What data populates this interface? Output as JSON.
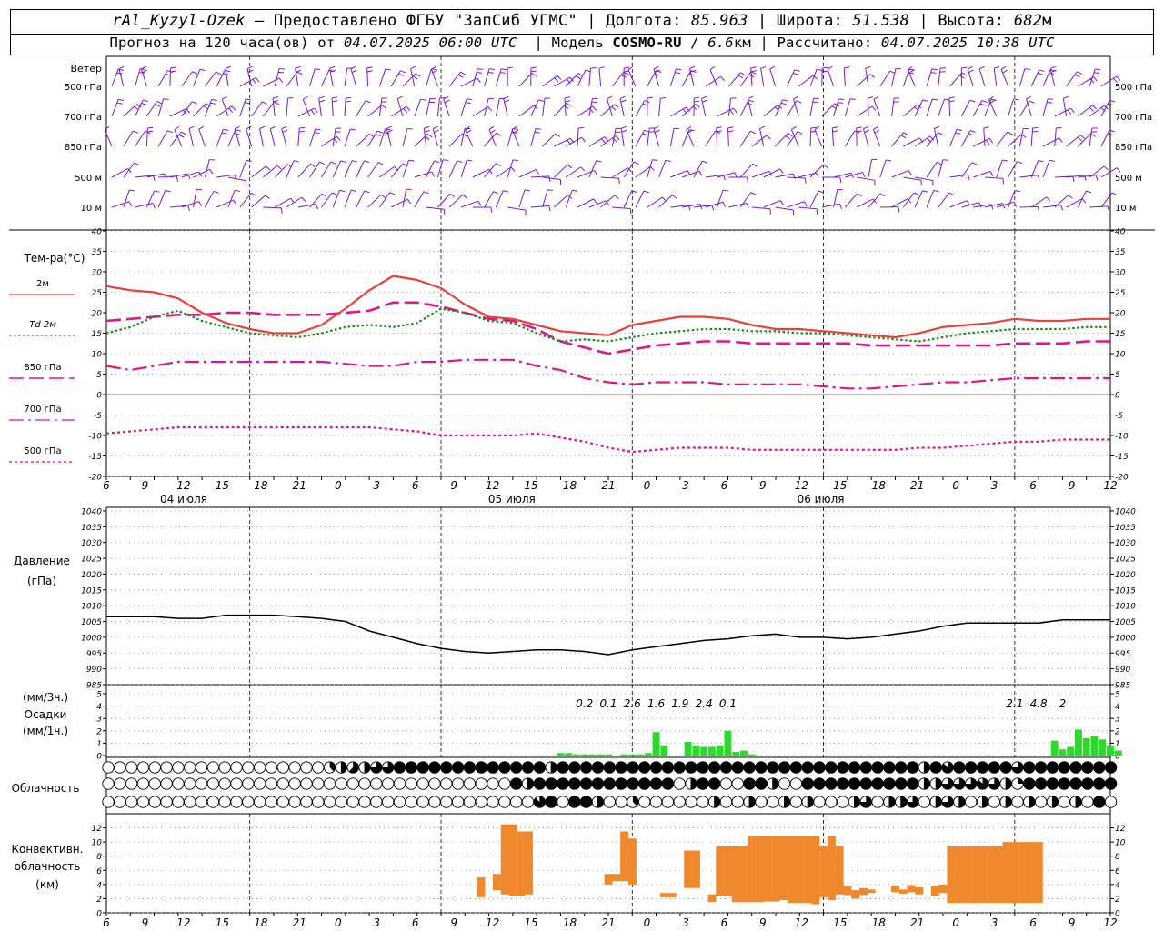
{
  "header": {
    "station": "rAl_Kyzyl-Ozek",
    "provider": "Предоставлено ФГБУ \"ЗапСиб УГМС\"",
    "lon_label": "Долгота:",
    "lon_value": "85.963",
    "lat_label": "Широта:",
    "lat_value": "51.538",
    "alt_label": "Высота:",
    "alt_value": "682",
    "alt_unit": "м",
    "forecast_prefix": "Прогноз на 120 часа(ов) от",
    "forecast_time": "04.07.2025 06:00 UTC",
    "model_label": "Модель",
    "model_name": "COSMO-RU",
    "model_res": "6.6",
    "model_res_unit": "км",
    "calc_label": "Рассчитано:",
    "calc_time": "04.07.2025 10:38 UTC"
  },
  "wind_panel": {
    "title": "Ветер",
    "levels": [
      "500 гПа",
      "700 гПа",
      "850 гПа",
      "500 м",
      "10 м"
    ],
    "barb_color": "#7b19d0"
  },
  "chart_data": [
    {
      "type": "line",
      "name": "temperature",
      "ylabel": "Тем-ра(°С)",
      "ylim": [
        -20,
        40
      ],
      "yticks": [
        -20,
        -15,
        -10,
        -5,
        0,
        5,
        10,
        15,
        20,
        25,
        30,
        35,
        40
      ],
      "x_hours_from_start": [
        0,
        3,
        6,
        9,
        12,
        15,
        18,
        21,
        24,
        27,
        30,
        33,
        36,
        39,
        42,
        45,
        48,
        51,
        54,
        57,
        60,
        63,
        66,
        69,
        72,
        75,
        78,
        81,
        84,
        87,
        90,
        93,
        96,
        99,
        102,
        105,
        108,
        111,
        114,
        117,
        120,
        123,
        126
      ],
      "legend": [
        {
          "label": "2м",
          "color": "#e8403a"
        },
        {
          "label": "Td  2м",
          "color": "#1b8a1b"
        },
        {
          "label": "850 гПа",
          "color": "#e0148c"
        },
        {
          "label": "700 гПа",
          "color": "#e0148c"
        },
        {
          "label": "500 гПа",
          "color": "#e0148c"
        }
      ],
      "series": [
        {
          "name": "2м",
          "color": "#e8403a",
          "values": [
            26.5,
            25.5,
            25,
            23.5,
            20,
            17.5,
            16,
            15,
            15,
            17,
            21,
            25.5,
            29,
            28,
            26,
            22,
            19,
            18.5,
            17,
            15.5,
            15,
            14.5,
            17,
            18,
            19,
            19,
            18.5,
            17,
            16,
            16,
            15.5,
            15,
            14.5,
            14,
            15,
            16.5,
            17,
            17.5,
            18.5,
            18,
            18,
            18.5,
            18.5
          ]
        },
        {
          "name": "Td  2м",
          "color": "#1b8a1b",
          "values": [
            15,
            16.5,
            19,
            20.5,
            18,
            16.5,
            15,
            14.5,
            14,
            15,
            16.5,
            17,
            16.5,
            17.5,
            21,
            20,
            18,
            17.5,
            15,
            13,
            13.5,
            13,
            14,
            15,
            15.5,
            16,
            16,
            15.5,
            15.5,
            15,
            15,
            14.5,
            14,
            13.5,
            13,
            14,
            15,
            15.5,
            16,
            16,
            16,
            16.5,
            16.5
          ]
        },
        {
          "name": "850 гПа",
          "color": "#e0148c",
          "values": [
            18,
            18.5,
            19,
            19.5,
            19.5,
            20,
            20,
            19.5,
            19.5,
            19.5,
            20,
            20.5,
            22.5,
            22.5,
            21.5,
            20,
            18.5,
            18,
            16,
            13,
            11.5,
            10,
            11,
            12,
            12.5,
            13,
            13,
            12.5,
            12.5,
            12.5,
            12.5,
            12.5,
            12,
            12,
            12,
            12,
            12,
            12,
            12.5,
            12.5,
            12.5,
            13,
            13
          ]
        },
        {
          "name": "700 гПа",
          "color": "#e0148c",
          "values": [
            7,
            6,
            7,
            8,
            8,
            8,
            8,
            8,
            8,
            8,
            7.5,
            7,
            7,
            8,
            8,
            8.5,
            8.5,
            8.5,
            7,
            6,
            4,
            3,
            2.5,
            3,
            3,
            3,
            2.5,
            2.5,
            2.5,
            2.5,
            2,
            1.5,
            1.5,
            2,
            2.5,
            3,
            3,
            3.5,
            4,
            4,
            4,
            4,
            4
          ]
        },
        {
          "name": "500 гПа",
          "color": "#e0148c",
          "values": [
            -9.5,
            -9,
            -8.5,
            -8,
            -8,
            -8,
            -8,
            -8,
            -8,
            -8,
            -8,
            -8,
            -8.5,
            -9,
            -10,
            -10,
            -10,
            -10,
            -9.5,
            -10.5,
            -11.5,
            -13,
            -14,
            -13.5,
            -13,
            -13,
            -13,
            -13.5,
            -13.5,
            -13.5,
            -13.5,
            -13.5,
            -13.5,
            -13.5,
            -13,
            -13,
            -12.5,
            -12,
            -11.5,
            -11.5,
            -11,
            -11,
            -11
          ]
        }
      ]
    },
    {
      "type": "line",
      "name": "pressure",
      "ylabel": "Давление",
      "ylabel2": "(гПа)",
      "ylim": [
        985,
        1040
      ],
      "yticks": [
        985,
        990,
        995,
        1000,
        1005,
        1010,
        1015,
        1020,
        1025,
        1030,
        1035,
        1040
      ],
      "x_hours_from_start": [
        0,
        3,
        6,
        9,
        12,
        15,
        18,
        21,
        24,
        27,
        30,
        33,
        36,
        39,
        42,
        45,
        48,
        51,
        54,
        57,
        60,
        63,
        66,
        69,
        72,
        75,
        78,
        81,
        84,
        87,
        90,
        93,
        96,
        99,
        102,
        105,
        108,
        111,
        114,
        117,
        120,
        123,
        126
      ],
      "series": [
        {
          "name": "pressure",
          "color": "#000000",
          "values": [
            1006.5,
            1006.5,
            1006.5,
            1006,
            1006,
            1007,
            1007,
            1007,
            1006.5,
            1006,
            1005,
            1002,
            1000,
            998,
            996.5,
            995.5,
            995,
            995.5,
            996,
            996,
            995.5,
            994.5,
            996,
            997,
            998,
            999,
            999.5,
            1000.5,
            1001,
            1000,
            1000,
            999.5,
            1000,
            1001,
            1002,
            1003.5,
            1004.5,
            1004.5,
            1004.5,
            1004.5,
            1005.5,
            1005.5,
            1005.5
          ]
        }
      ]
    },
    {
      "type": "bar",
      "name": "precipitation",
      "ylabel": "(мм/3ч.)",
      "ylabel2": "Осадки",
      "ylabel3": "(мм/1ч.)",
      "ylim": [
        0,
        5
      ],
      "yticks": [
        0,
        1,
        2,
        3,
        4,
        5
      ],
      "bar_color": "#2ed92e",
      "hourly_start_hour": 57,
      "hourly_values": [
        0.2,
        0.2,
        0.1,
        0.1,
        0.1,
        0.1,
        0.1,
        0,
        0.1,
        0.1,
        0.1,
        0.2,
        1.9,
        0.8,
        0,
        0,
        1.1,
        0.8,
        0.7,
        0.7,
        0.8,
        2.0,
        0.3,
        0.4,
        0.1,
        0,
        0,
        0,
        0,
        0,
        0,
        0,
        0,
        0,
        0,
        0,
        0,
        0,
        0,
        0,
        0,
        0,
        0,
        0,
        0,
        0,
        0,
        0,
        0,
        0,
        0,
        0,
        0,
        0,
        0,
        0,
        0,
        0,
        0,
        0,
        0,
        0,
        1.2,
        0.5,
        0.7,
        2.1,
        1.4,
        1.6,
        1.3,
        0.8,
        0.4
      ],
      "totals_3h": [
        {
          "x": 60,
          "label": "0.2"
        },
        {
          "x": 63,
          "label": "0.1"
        },
        {
          "x": 66,
          "label": "2.6"
        },
        {
          "x": 69,
          "label": "1.6"
        },
        {
          "x": 72,
          "label": "1.9"
        },
        {
          "x": 75,
          "label": "2.4"
        },
        {
          "x": 78,
          "label": "0.1"
        },
        {
          "x": 114,
          "label": "2.1"
        },
        {
          "x": 117,
          "label": "4.8"
        },
        {
          "x": 120,
          "label": "2"
        }
      ]
    },
    {
      "type": "table",
      "name": "cloudiness",
      "ylabel": "Облачность",
      "rows_eighths": [
        [
          0,
          0,
          0,
          0,
          0,
          0,
          0,
          0,
          0,
          0,
          0,
          0,
          0,
          0,
          0,
          0,
          0,
          0,
          0,
          3,
          4,
          5,
          4,
          6,
          6,
          8,
          8,
          8,
          8,
          8,
          8,
          8,
          8,
          8,
          8,
          8,
          8,
          8,
          4,
          8,
          8,
          8,
          8,
          8,
          8,
          8,
          8,
          8,
          8,
          8,
          8,
          8,
          8,
          8,
          8,
          8,
          8,
          8,
          8,
          8,
          8,
          8,
          8,
          8,
          8,
          8,
          8,
          8,
          8,
          8,
          4,
          8,
          7,
          8,
          8,
          8,
          8,
          8,
          6,
          8,
          8,
          8,
          8,
          8,
          8,
          8,
          8
        ],
        [
          0,
          0,
          0,
          0,
          0,
          0,
          0,
          0,
          0,
          0,
          0,
          0,
          0,
          0,
          0,
          0,
          0,
          0,
          0,
          0,
          0,
          0,
          0,
          0,
          0,
          0,
          0,
          0,
          0,
          0,
          0,
          0,
          0,
          0,
          0,
          8,
          4,
          8,
          8,
          8,
          8,
          8,
          8,
          8,
          8,
          8,
          8,
          8,
          8,
          0,
          4,
          8,
          8,
          0,
          0,
          8,
          8,
          4,
          0,
          0,
          8,
          8,
          8,
          8,
          8,
          8,
          8,
          8,
          8,
          8,
          4,
          4,
          6,
          6,
          6,
          7,
          6,
          4,
          2,
          8,
          8,
          8,
          8,
          8,
          8,
          8,
          8
        ],
        [
          0,
          0,
          0,
          0,
          0,
          0,
          0,
          0,
          0,
          0,
          0,
          0,
          0,
          0,
          0,
          0,
          0,
          0,
          0,
          0,
          0,
          0,
          0,
          0,
          0,
          0,
          0,
          0,
          0,
          0,
          0,
          0,
          0,
          0,
          0,
          0,
          0,
          7,
          8,
          0,
          8,
          8,
          4,
          0,
          0,
          3,
          0,
          0,
          0,
          0,
          0,
          0,
          4,
          0,
          0,
          4,
          0,
          0,
          4,
          0,
          4,
          0,
          0,
          0,
          4,
          6,
          0,
          4,
          4,
          6,
          0,
          4,
          6,
          4,
          0,
          4,
          0,
          4,
          0,
          4,
          0,
          4,
          0,
          4,
          0,
          8,
          0
        ]
      ]
    },
    {
      "type": "bar",
      "name": "convective_cloudiness",
      "ylabel": "Конвективн.",
      "ylabel2": "облачность",
      "ylabel3": "(км)",
      "ylim": [
        0,
        14
      ],
      "yticks": [
        0,
        2,
        4,
        6,
        8,
        10,
        12
      ],
      "bar_color": "#f0892e",
      "hourly_start_hour": 47,
      "hourly_bottom_km": [
        2.2,
        0,
        3.2,
        2.6,
        2.4,
        2.4,
        2.6,
        0,
        0,
        0,
        0,
        0,
        0,
        0,
        0,
        0,
        4,
        4.5,
        4.5,
        4,
        0,
        0,
        0,
        2.2,
        2.2,
        0,
        3.5,
        3.5,
        0,
        1.5,
        2.4,
        2.4,
        1.5,
        1.5,
        1.5,
        1.5,
        1.6,
        1.6,
        1.8,
        1.4,
        1.4,
        1.4,
        1.2,
        2.2,
        1.8,
        2.6,
        2.5,
        2,
        2.5,
        2.8,
        0,
        0,
        2.9,
        2.7,
        2.9,
        2.6,
        0,
        2.4,
        2.8,
        1.4,
        1.4,
        1.4,
        1.4,
        1.4,
        1.4,
        1.4,
        1.4,
        1.4,
        1.4,
        1.4,
        1.4
      ],
      "hourly_top_km": [
        5,
        0,
        5.5,
        12.5,
        12.5,
        11.5,
        11.5,
        0,
        0,
        0,
        0,
        0,
        0,
        0,
        0,
        0,
        5.5,
        5.5,
        11.5,
        10.5,
        0,
        0,
        0,
        2.8,
        2.8,
        0,
        8.8,
        8.8,
        0,
        2.6,
        9.4,
        9.4,
        9.4,
        9.4,
        10.8,
        10.8,
        10.8,
        10.8,
        10.8,
        10.8,
        10.8,
        10.8,
        10.8,
        9.4,
        10.8,
        9.4,
        3.8,
        3.2,
        3.5,
        3.3,
        0,
        0,
        3.8,
        3.3,
        3.9,
        3.6,
        0,
        3.8,
        4,
        9.4,
        9.4,
        9.4,
        9.4,
        9.4,
        9.4,
        9.4,
        10,
        10,
        10,
        10,
        10
      ]
    }
  ],
  "time_axis": {
    "tick_labels": [
      "6",
      "9",
      "12",
      "15",
      "18",
      "21",
      "0",
      "3",
      "6",
      "9",
      "12",
      "15",
      "18",
      "21",
      "0",
      "3",
      "6",
      "9",
      "12",
      "15",
      "18",
      "21",
      "0",
      "3",
      "6",
      "9",
      "12"
    ],
    "day_labels": [
      {
        "hour": 6,
        "label": "04 июля"
      },
      {
        "hour": 30,
        "label": "05 июля"
      },
      {
        "hour": 54,
        "label": "06 июля"
      }
    ],
    "midnights_hours_from_start": [
      18,
      42,
      66,
      90,
      114
    ]
  }
}
